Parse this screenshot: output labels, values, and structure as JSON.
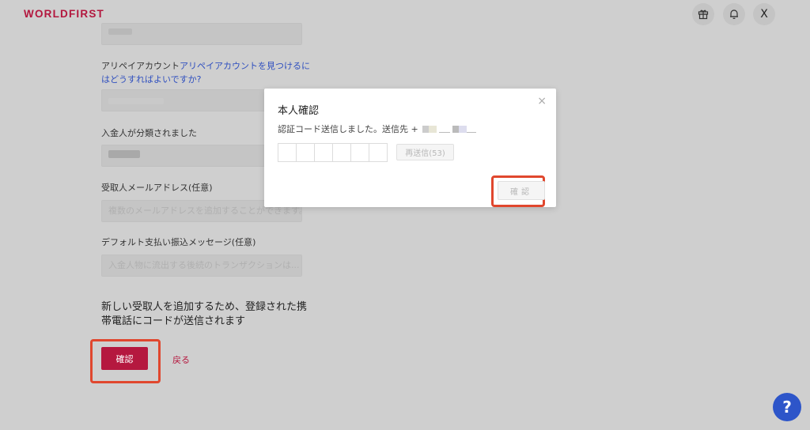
{
  "header": {
    "logo": "WORLDFIRST",
    "close_label": "X"
  },
  "form": {
    "account_label": "アリペイアカウント",
    "account_link_line1": "アリペイアカウントを見つけるに",
    "account_link_line2": "はどうすればよいですか?",
    "classified_label": "入金人が分類されました",
    "email_label": "受取人メールアドレス(任意)",
    "email_placeholder": "複数のメールアドレスを追加することができます。",
    "message_label": "デフォルト支払い振込メッセージ(任意)",
    "message_placeholder": "入金人物に流出する後続のトランザクションは...",
    "note": "新しい受取人を追加するため、登録された携帯電話にコードが送信されます",
    "confirm_label": "確認",
    "back_label": "戻る"
  },
  "modal": {
    "title": "本人確認",
    "description": "認証コード送信しました。送信先 +",
    "resend_label": "再送信(53)",
    "confirm_label": "確認",
    "close_symbol": "×"
  },
  "help_label": "?",
  "colors": {
    "brand": "#b5183f",
    "link": "#2f4fbf",
    "help": "#2d55c9",
    "highlight": "#e0472e"
  }
}
